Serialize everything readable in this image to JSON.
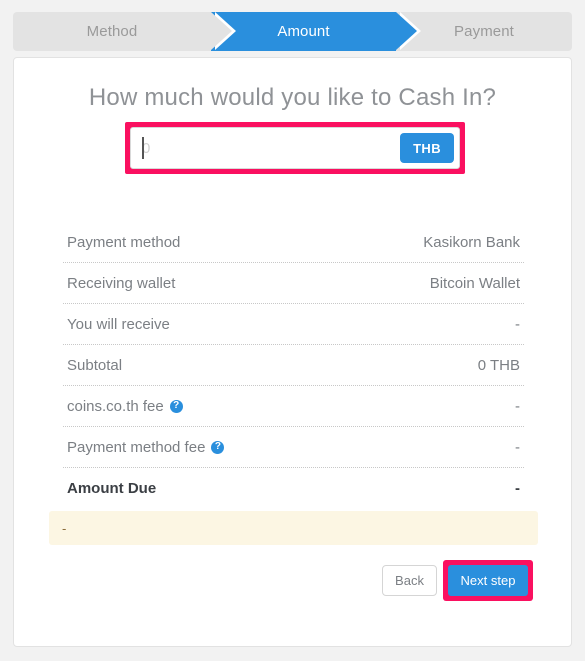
{
  "stepper": {
    "steps": [
      {
        "label": "Method",
        "state": "done"
      },
      {
        "label": "Amount",
        "state": "active"
      },
      {
        "label": "Payment",
        "state": "upcoming"
      }
    ]
  },
  "main": {
    "title": "How much would you like to Cash In?",
    "amount": {
      "value": "",
      "placeholder": "0",
      "currency_label": "THB"
    },
    "summary": {
      "rows": [
        {
          "label": "Payment method",
          "value": "Kasikorn Bank",
          "help": false,
          "bold": false
        },
        {
          "label": "Receiving wallet",
          "value": "Bitcoin Wallet",
          "help": false,
          "bold": false
        },
        {
          "label": "You will receive",
          "value": "-",
          "help": false,
          "bold": false
        },
        {
          "label": "Subtotal",
          "value": "0 THB",
          "help": false,
          "bold": false
        },
        {
          "label": "coins.co.th fee",
          "value": "-",
          "help": true,
          "bold": false
        },
        {
          "label": "Payment method fee",
          "value": "-",
          "help": true,
          "bold": false
        },
        {
          "label": "Amount Due",
          "value": "-",
          "help": false,
          "bold": true
        }
      ],
      "help_glyph": "?"
    },
    "alert": {
      "text": "-"
    },
    "footer": {
      "back_label": "Back",
      "next_label": "Next step"
    }
  },
  "colors": {
    "accent_blue": "#2a8fdd",
    "highlight_pink": "#fa1060",
    "alert_bg": "#fcf6e3",
    "page_bg": "#f2f2f2"
  }
}
